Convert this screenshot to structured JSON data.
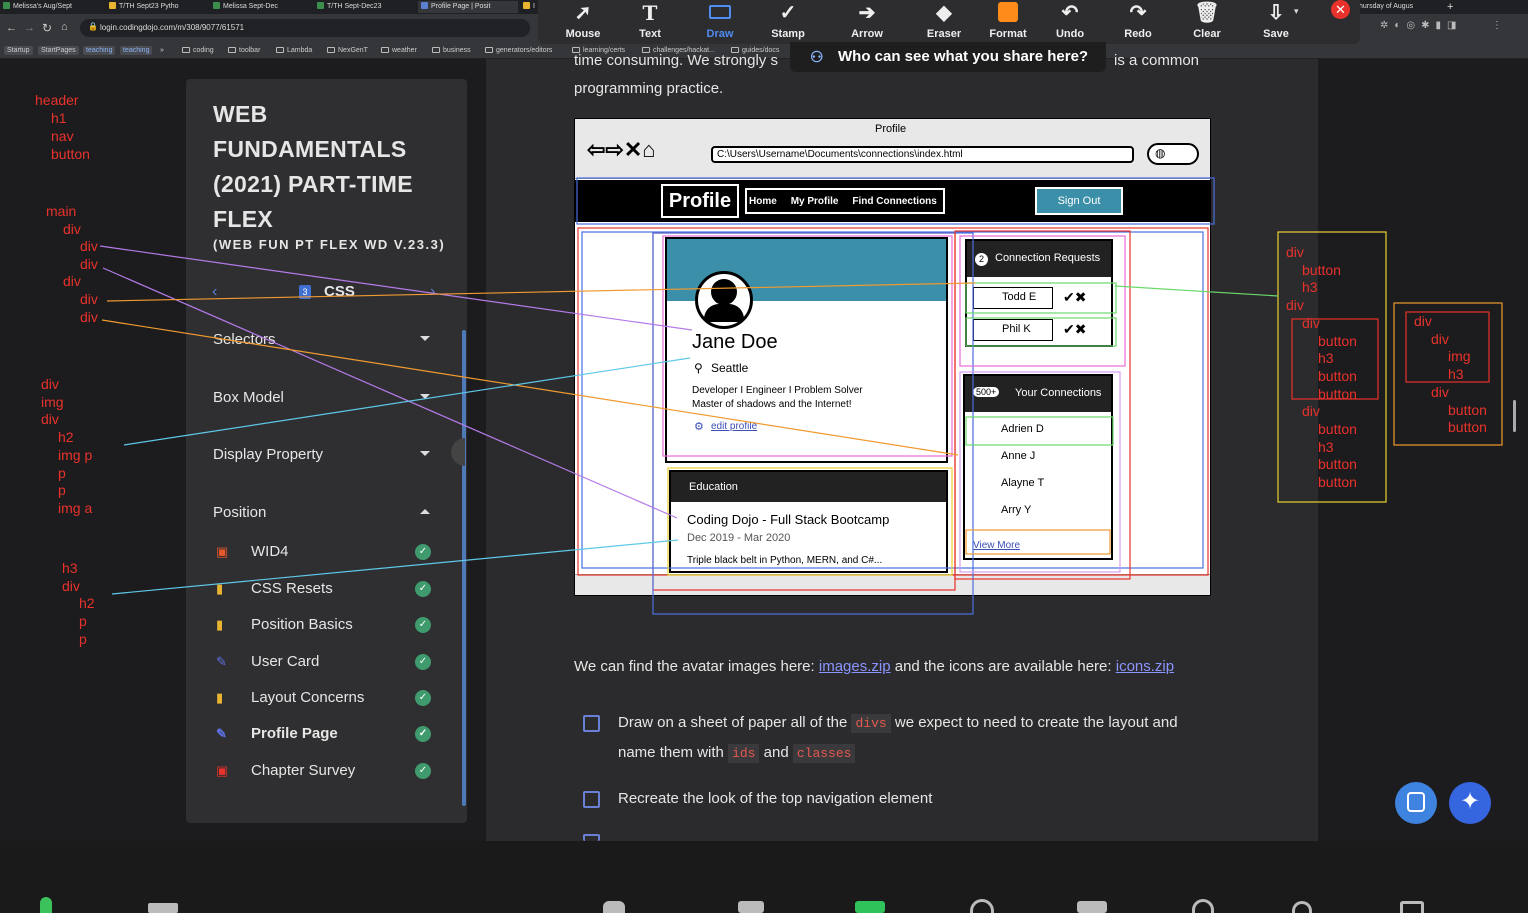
{
  "browser": {
    "tabs": [
      "Melissa's Aug/Sept",
      "T/TH Sept23 Pytho",
      "Melissa Sept-Dec",
      "T/TH Sept-Dec23",
      "Profile Page | Posit",
      "I"
    ],
    "tabs_right": [
      "hursday of Augus"
    ],
    "url": "login.codingdojo.com/m/308/9077/61571",
    "bookmarks": [
      "Startup",
      "StartPages",
      "teaching",
      "teaching",
      "»",
      "coding",
      "toolbar",
      "Lambda",
      "NexGenT",
      "weather",
      "business",
      "generators/editors",
      "learning/certs",
      "challenges/hackat...",
      "guides/docs"
    ]
  },
  "annotate_toolbar": {
    "tools": [
      "Mouse",
      "Text",
      "Draw",
      "Stamp",
      "Arrow",
      "Eraser",
      "Format",
      "Undo",
      "Redo",
      "Clear",
      "Save"
    ],
    "active": "Draw",
    "share_text": "Who can see what you share here?"
  },
  "sidebar": {
    "title": "WEB FUNDAMENTALS (2021) PART-TIME FLEX",
    "subtitle": "(WEB FUN PT FLEX WD V.23.3)",
    "nav_label": "CSS",
    "sections": [
      "Selectors",
      "Box Model",
      "Display Property",
      "Position"
    ],
    "lessons": [
      {
        "label": "WID4",
        "icon": "html5-icon"
      },
      {
        "label": "CSS Resets",
        "icon": "book-icon"
      },
      {
        "label": "Position Basics",
        "icon": "book-icon"
      },
      {
        "label": "User Card",
        "icon": "pencil-icon"
      },
      {
        "label": "Layout Concerns",
        "icon": "book-icon"
      },
      {
        "label": "Profile Page",
        "icon": "pencil-icon"
      },
      {
        "label": "Chapter Survey",
        "icon": "survey-icon"
      }
    ]
  },
  "annotations_left": {
    "group1": [
      "header",
      "h1",
      "nav",
      "button"
    ],
    "group2": [
      "main",
      "div",
      "div",
      "div",
      "div",
      "div",
      "div"
    ],
    "group3": [
      "div",
      "img",
      "div",
      "h2",
      "img p",
      "p",
      "p",
      "img a"
    ],
    "group4": [
      "h3",
      "div",
      "h2",
      "p",
      "p"
    ]
  },
  "annotations_right": {
    "group1": [
      "div",
      "button",
      "h3",
      "div",
      "div",
      "button",
      "h3",
      "button",
      "button",
      "div",
      "button",
      "h3",
      "button",
      "button"
    ],
    "group2": [
      "div",
      "div",
      "img",
      "h3",
      "div",
      "button",
      "button"
    ]
  },
  "content": {
    "top_fragment_left": "time consuming. We strongly s",
    "top_fragment_right": "is a common",
    "top_line": "programming practice.",
    "assets_text_1": "We can find the avatar images here:",
    "assets_link_1": "images.zip",
    "assets_text_2": "and the icons are available here:",
    "assets_link_2": "icons.zip",
    "task1_a": "Draw on a sheet of paper all of the",
    "task1_code1": "divs",
    "task1_b": "we expect to need to create the layout and",
    "task1_c": "name them with",
    "task1_code2": "ids",
    "task1_and": "and",
    "task1_code3": "classes",
    "task2": "Recreate the look of the top navigation element"
  },
  "wireframe": {
    "window_title": "Profile",
    "path": "C:\\Users\\Username\\Documents\\connections\\index.html",
    "brand": "Profile",
    "nav": [
      "Home",
      "My Profile",
      "Find Connections"
    ],
    "sign_out": "Sign Out",
    "name": "Jane Doe",
    "city": "Seattle",
    "bio1": "Developer I Engineer I Problem Solver",
    "bio2": "Master of shadows and the Internet!",
    "edit": "edit profile",
    "edu_title": "Education",
    "school": "Coding Dojo - Full Stack Bootcamp",
    "dates": "Dec 2019 - Mar 2020",
    "desc": "Triple black belt in Python, MERN, and C#...",
    "req_count": "2",
    "req_title": "Connection Requests",
    "requests": [
      "Todd E",
      "Phil K"
    ],
    "conn_count": "500+",
    "conn_title": "Your Connections",
    "connections": [
      "Adrien D",
      "Anne J",
      "Alayne T",
      "Arry Y"
    ],
    "view_more": "View More"
  },
  "colors": {
    "accent": "#3d83df",
    "annotation_red": "#e8322b",
    "check_green": "#3f9a6d",
    "teal": "#3b8fa8"
  }
}
